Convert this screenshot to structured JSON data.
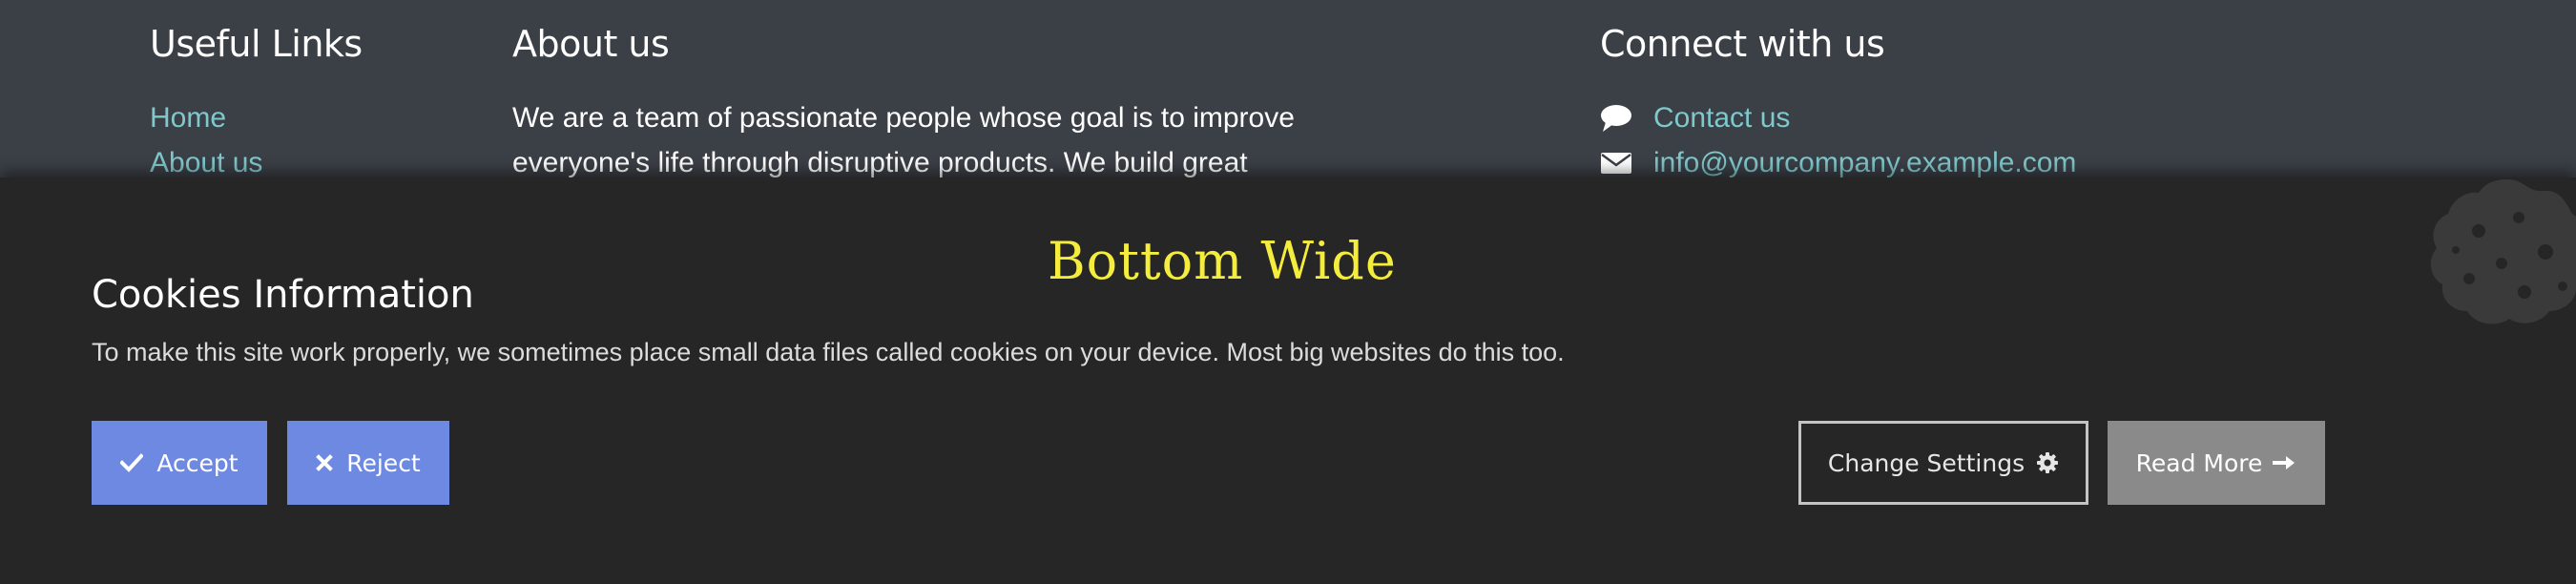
{
  "footer": {
    "useful_links": {
      "title": "Useful Links",
      "items": [
        {
          "label": "Home"
        },
        {
          "label": "About us"
        }
      ]
    },
    "about": {
      "title": "About us",
      "text": "We are a team of passionate people whose goal is to improve everyone's life through disruptive products. We build great"
    },
    "connect": {
      "title": "Connect with us",
      "items": [
        {
          "icon": "comment-icon",
          "label": "Contact us"
        },
        {
          "icon": "envelope-icon",
          "label": "info@yourcompany.example.com"
        }
      ]
    }
  },
  "banner": {
    "heading": "Bottom Wide",
    "title": "Cookies Information",
    "text": "To make this site work properly, we sometimes place small data files called cookies on your device. Most big websites do this too.",
    "buttons": {
      "accept": "Accept",
      "reject": "Reject",
      "change_settings": "Change Settings",
      "read_more": "Read More"
    }
  },
  "colors": {
    "footer_bg": "#3b3f46",
    "banner_bg": "#262626",
    "link": "#7fc8cc",
    "heading_yellow": "#f5ed3d",
    "primary_button": "#6d89e2",
    "secondary_button": "#8a8a8a"
  }
}
